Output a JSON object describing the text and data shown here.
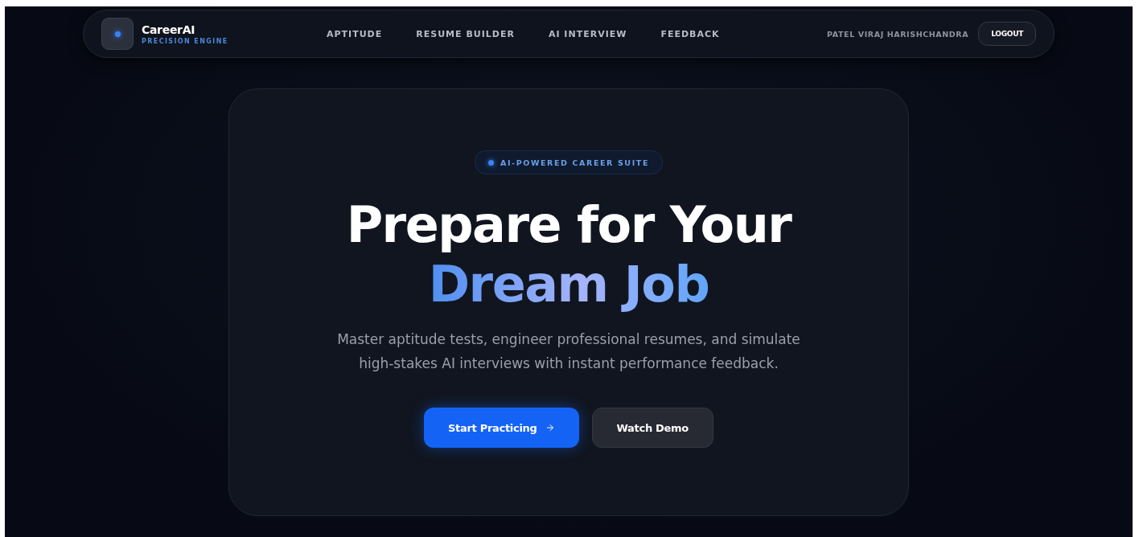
{
  "brand": {
    "name": "CareerAI",
    "tagline": "PRECISION ENGINE"
  },
  "nav": [
    "APTITUDE",
    "RESUME BUILDER",
    "AI INTERVIEW",
    "FEEDBACK"
  ],
  "user": {
    "name": "PATEL VIRAJ HARISHCHANDRA",
    "logout": "LOGOUT"
  },
  "hero": {
    "badge": "AI-POWERED CAREER SUITE",
    "title": "Prepare for Your",
    "highlight": "Dream Job",
    "subtitle": "Master aptitude tests, engineer professional resumes, and simulate high-stakes AI interviews with instant performance feedback.",
    "primary": "Start Practicing",
    "secondary": "Watch Demo"
  }
}
